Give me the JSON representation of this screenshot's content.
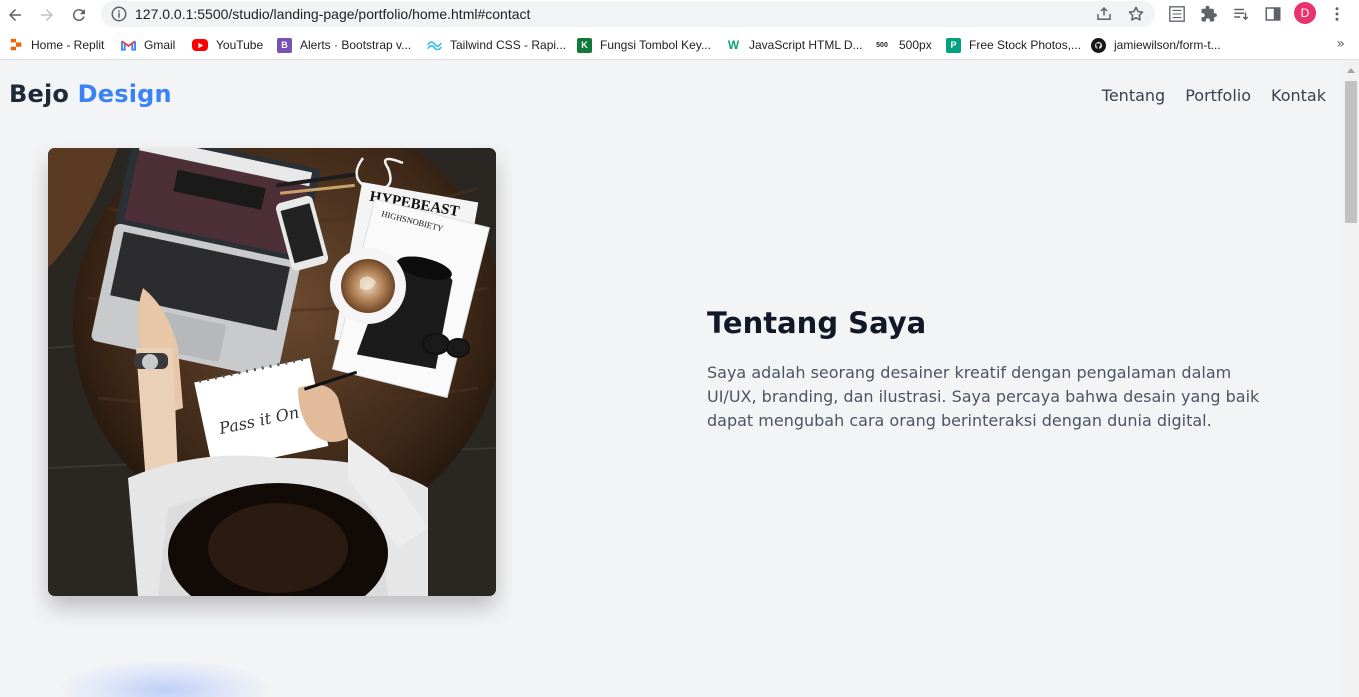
{
  "browser": {
    "url": "127.0.0.1:5500/studio/landing-page/portfolio/home.html#contact",
    "avatar_letter": "D",
    "bookmarks": [
      {
        "label": "Home - Replit",
        "icon": "replit-icon",
        "color": "#f26207"
      },
      {
        "label": "Gmail",
        "icon": "gmail-icon",
        "color": "#ea4335"
      },
      {
        "label": "YouTube",
        "icon": "youtube-icon",
        "color": "#ff0000"
      },
      {
        "label": "Alerts · Bootstrap v...",
        "icon": "bootstrap-icon",
        "color": "#7952b3"
      },
      {
        "label": "Tailwind CSS - Rapi...",
        "icon": "tailwind-icon",
        "color": "#38bdf8"
      },
      {
        "label": "Fungsi Tombol Key...",
        "icon": "keyboard-site-icon",
        "color": "#0f7a3a"
      },
      {
        "label": "JavaScript HTML D...",
        "icon": "w3schools-icon",
        "color": "#04aa6d"
      },
      {
        "label": "500px",
        "icon": "500px-icon",
        "color": "#222222"
      },
      {
        "label": "Free Stock Photos,...",
        "icon": "pexels-icon",
        "color": "#05a081"
      },
      {
        "label": "jamiewilson/form-t...",
        "icon": "github-icon",
        "color": "#181717"
      }
    ],
    "more_label": "»"
  },
  "page": {
    "brand_first": "Bejo",
    "brand_second": "Design",
    "nav": [
      "Tentang",
      "Portfolio",
      "Kontak"
    ],
    "about_title": "Tentang Saya",
    "about_text": "Saya adalah seorang desainer kreatif dengan pengalaman dalam UI/UX, branding, dan ilustrasi. Saya percaya bahwa desain yang baik dapat mengubah cara orang berinteraksi dengan dunia digital.",
    "photo_texts": {
      "magazine_1": "HYPEBEAST",
      "magazine_2": "HIGHSNOBIETY",
      "sketch": "Pass it On"
    }
  },
  "colors": {
    "accent": "#3b82f6",
    "brand_dark": "#1f2937",
    "page_bg": "#f3f4f6"
  }
}
